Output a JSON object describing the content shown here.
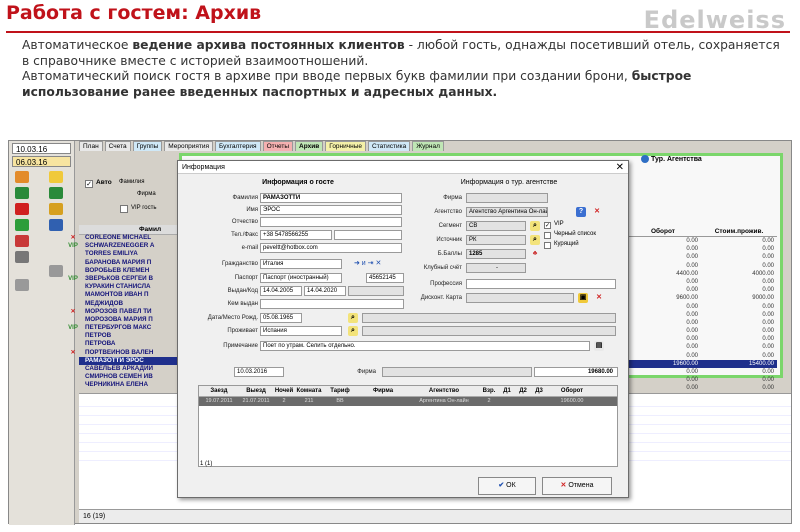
{
  "slide": {
    "title": "Работа с гостем: Архив",
    "brand": "Edelweiss",
    "paragraph1_a": "Автоматическое ",
    "paragraph1_b": "ведение архива постоянных клиентов",
    "paragraph1_c": " - любой гость, однажды посетивший отель, сохраняется в справочнике вместе с историей взаимоотношений.",
    "paragraph2_a": "Автоматический поиск гостя в архиве при вводе первых букв фамилии при создании брони, ",
    "paragraph2_b": "быстрое использование ранее введенных паспортных и адресных данных."
  },
  "app": {
    "dates": [
      "10.03.16",
      "06.03.16"
    ],
    "tabs": [
      "План",
      "Счета",
      "Группы",
      "Мероприятия",
      "Бухгалтерия",
      "Отчеты",
      "Архив",
      "Горничные",
      "Статистика",
      "Журнал"
    ],
    "tab_colors": [
      "#e8e8e8",
      "#e8e8e8",
      "#cfe8f7",
      "#e8e8e8",
      "#cfe8f7",
      "#f4b0b0",
      "#bfe6b5",
      "#f4f0a8",
      "#cfe8f7",
      "#bfe6b5"
    ],
    "auto_label": "Авто",
    "surname_label": "Фамилия",
    "firm_label": "Фирма",
    "vip_label": "VIP гость",
    "agency": "Тур. Агентства",
    "col_name": "Фамил",
    "col_turnover": "Оборот",
    "col_living": "Стоим.прожив.",
    "guests": [
      {
        "name": "CORLEONE MICHAEL",
        "mark": "✕",
        "turnover": "0.00",
        "living": "0.00"
      },
      {
        "name": "SCHWARZENEGGER A",
        "mark": "VIP",
        "turnover": "0.00",
        "living": "0.00"
      },
      {
        "name": "TORRES EMILIYA",
        "mark": "",
        "turnover": "0.00",
        "living": "0.00"
      },
      {
        "name": "БАРАНОВА МАРИЯ П",
        "mark": "",
        "turnover": "0.00",
        "living": "0.00"
      },
      {
        "name": "ВОРОБЬЕВ КЛЕМЕН",
        "mark": "",
        "turnover": "4400.00",
        "living": "4000.00"
      },
      {
        "name": "ЗВЕРЬКОВ СЕРГЕЙ В",
        "mark": "VIP",
        "turnover": "0.00",
        "living": "0.00"
      },
      {
        "name": "КУРАКИН СТАНИСЛА",
        "mark": "",
        "turnover": "0.00",
        "living": "0.00"
      },
      {
        "name": "МАМОНТОВ ИВАН П",
        "mark": "",
        "turnover": "9600.00",
        "living": "9000.00"
      },
      {
        "name": "МЕДЖИДОВ",
        "mark": "",
        "turnover": "0.00",
        "living": "0.00"
      },
      {
        "name": "МОРОЗОВ ПАВЕЛ ТИ",
        "mark": "✕",
        "turnover": "0.00",
        "living": "0.00"
      },
      {
        "name": "МОРОЗОВА МАРИЯ П",
        "mark": "",
        "turnover": "0.00",
        "living": "0.00"
      },
      {
        "name": "ПЕТЕРБУРГОВ МАКС",
        "mark": "VIP",
        "turnover": "0.00",
        "living": "0.00"
      },
      {
        "name": "ПЕТРОВ",
        "mark": "",
        "turnover": "0.00",
        "living": "0.00"
      },
      {
        "name": "ПЕТРОВА",
        "mark": "",
        "turnover": "0.00",
        "living": "0.00"
      },
      {
        "name": "ПОРТВЕЙНОВ ВАЛЕН",
        "mark": "✕",
        "turnover": "0.00",
        "living": "0.00"
      },
      {
        "name": "РАМАЗОТТИ ЭРОС",
        "mark": "",
        "turnover": "19600.00",
        "living": "15400.00",
        "selected": true
      },
      {
        "name": "САВЕЛЬЕВ АРКАДИЙ",
        "mark": "",
        "turnover": "0.00",
        "living": "0.00"
      },
      {
        "name": "СМИРНОВ СЕМЁН ИВ",
        "mark": "",
        "turnover": "0.00",
        "living": "0.00"
      },
      {
        "name": "ЧЕРНИКИНА ЕЛЕНА",
        "mark": "",
        "turnover": "0.00",
        "living": "0.00"
      }
    ],
    "status_count": "16 (19)"
  },
  "dialog": {
    "title": "Информация",
    "guest_section": "Информация о госте",
    "agency_section": "Информация о тур. агентстве",
    "labels": {
      "surname": "Фамилия",
      "name": "Имя",
      "patronymic": "Отчество",
      "phone": "Тел./Факс",
      "email": "e-mail",
      "citizenship": "Гражданство",
      "passport": "Паспорт",
      "issued": "Выдан/Код",
      "issuedby": "Кем выдан",
      "birth": "Дата/Место Рожд.",
      "residence": "Проживает",
      "note": "Примечание",
      "firm": "Фирма",
      "agency": "Агентство",
      "segment": "Сегмент",
      "source": "Источник",
      "points": "Б.Баллы",
      "club": "Клубный счёт",
      "profession": "Профессия",
      "card": "Дисконт. Карта",
      "vip": "VIP",
      "blacklist": "Черный список",
      "smoker": "Курящий",
      "firm2": "Фирма"
    },
    "values": {
      "surname": "РАМАЗОТТИ",
      "name": "ЭРОС",
      "patronymic": "",
      "phone": "+38 5478566255",
      "email": "peveltt@hotbox.com",
      "citizenship": "Италия",
      "passport_type": "Паспорт (иностранный)",
      "passport_number": "45652145",
      "issued_date": "14.04.2005",
      "expiry_date": "14.04.2020",
      "issuedby": "",
      "birth": "05.08.1965",
      "residence": "Испания",
      "note": "Поет по утрам. Селить отдельно.",
      "agency": "Агентство Аргентина Он-лайн",
      "segment": "СВ",
      "source": "РК",
      "points": "1285",
      "club": "-",
      "date_filter": "10.03.2016",
      "total": "19680.00",
      "footer_count": "1 (1)"
    },
    "grid_columns": [
      "Заезд",
      "Выезд",
      "Ночей",
      "Комната",
      "Тариф",
      "Фирма",
      "Агентство",
      "Взр.",
      "Д1",
      "Д2",
      "Д3",
      "Оборот"
    ],
    "grid_row": [
      "19.07.2011",
      "21.07.2011",
      "2",
      "211",
      "ВВ",
      "",
      "Аргентина Он-лайн",
      "2",
      "",
      "",
      "",
      "19600.00"
    ],
    "ok_label": "ОК",
    "cancel_label": "Отмена"
  }
}
